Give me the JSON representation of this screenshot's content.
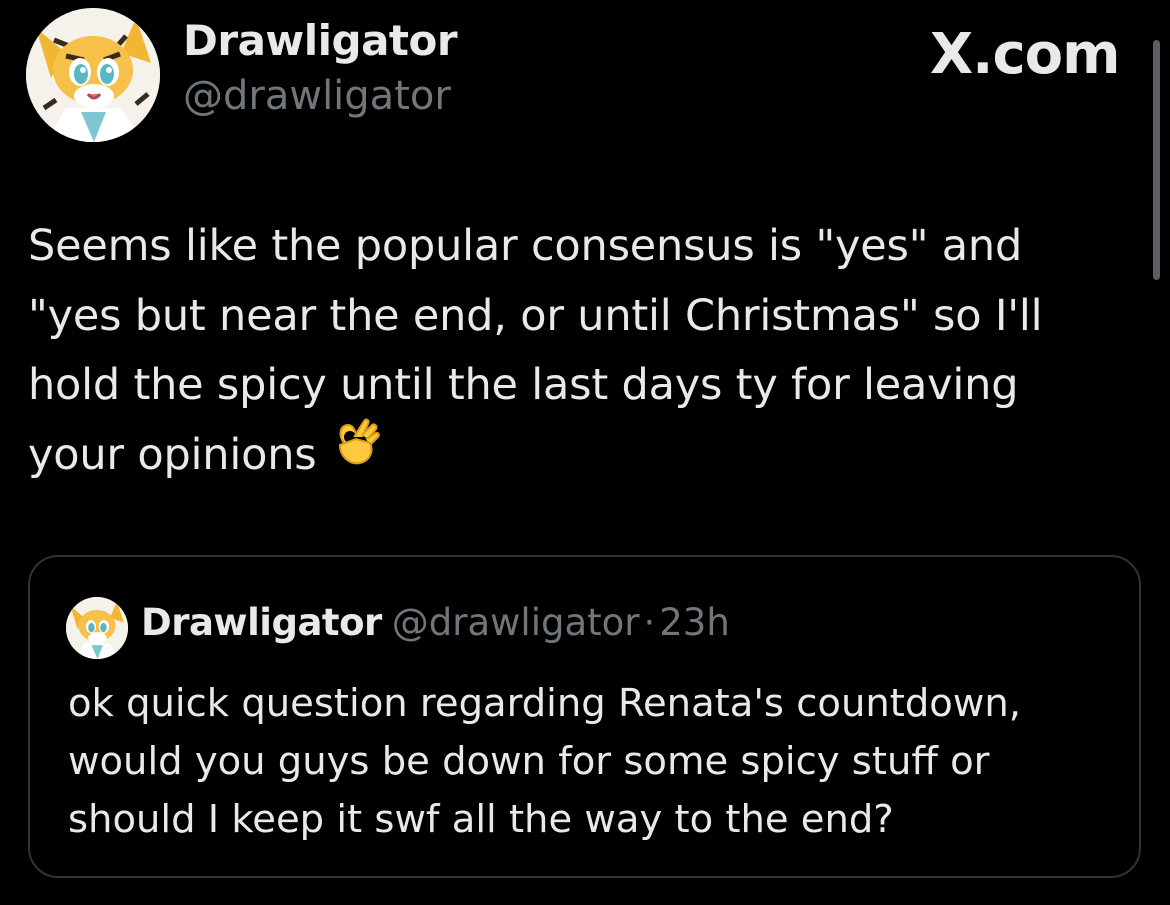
{
  "author": {
    "display_name": "Drawligator",
    "handle": "@drawligator",
    "avatar_icon": "tiger-character-avatar-icon"
  },
  "brand": {
    "label": "X.com"
  },
  "tweet": {
    "text": "Seems like the popular consensus is \"yes\" and\n\"yes but near the end, or until Christmas\" so I'll\nhold the spicy until the last days ty for leaving\nyour opinions",
    "emoji_icon": "ok-hand-emoji-icon"
  },
  "quoted_tweet": {
    "display_name": "Drawligator",
    "handle": "@drawligator",
    "separator": "·",
    "time": "23h",
    "text": "ok quick question regarding Renata's countdown,\nwould you guys be down for some spicy stuff or\nshould I keep it swf all the way to the end?"
  },
  "colors": {
    "background": "#000000",
    "primary_text": "#e7e9ea",
    "secondary_text": "#71767b",
    "border": "#2f3336"
  }
}
